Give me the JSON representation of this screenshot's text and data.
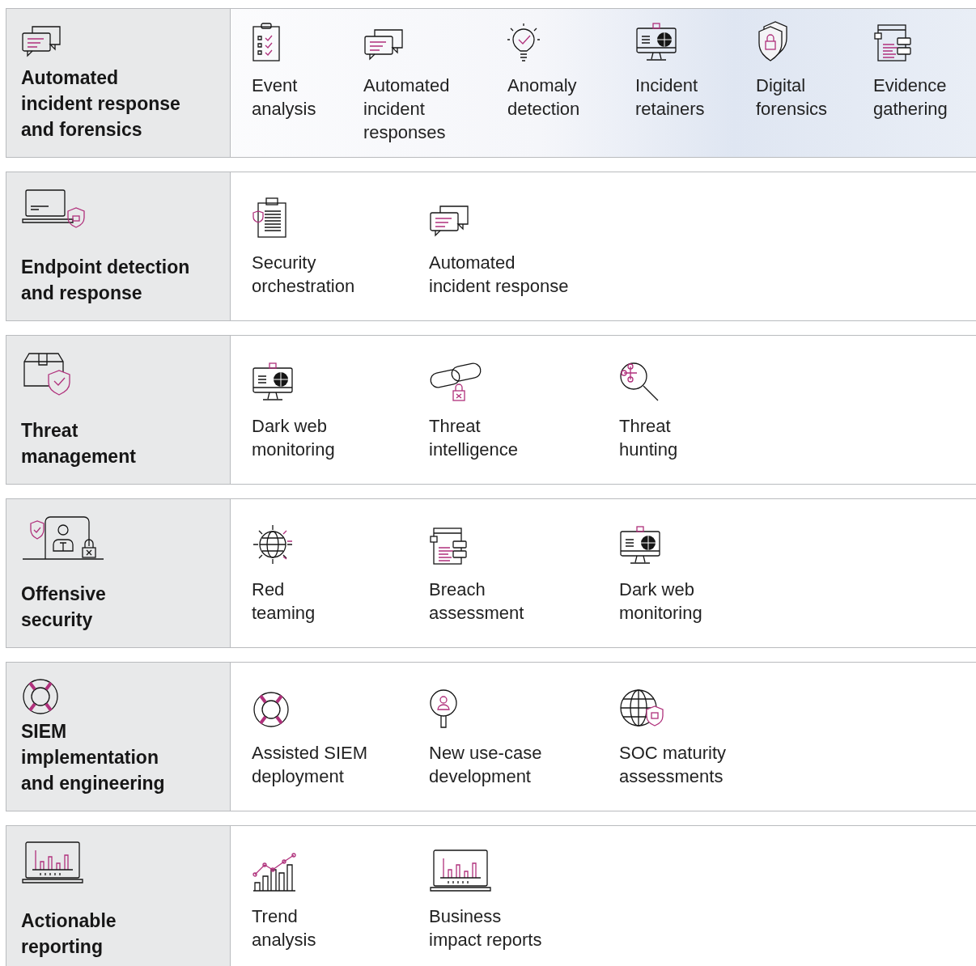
{
  "sections": [
    {
      "title": "Automated\nincident response\nand forensics",
      "items": [
        {
          "label": "Event\nanalysis"
        },
        {
          "label": "Automated\nincident\nresponses"
        },
        {
          "label": "Anomaly\ndetection"
        },
        {
          "label": "Incident\nretainers"
        },
        {
          "label": "Digital\nforensics"
        },
        {
          "label": "Evidence\ngathering"
        }
      ]
    },
    {
      "title": "Endpoint detection\nand response",
      "items": [
        {
          "label": "Security\norchestration"
        },
        {
          "label": "Automated\nincident response"
        }
      ]
    },
    {
      "title": "Threat\nmanagement",
      "items": [
        {
          "label": "Dark web\nmonitoring"
        },
        {
          "label": "Threat\nintelligence"
        },
        {
          "label": "Threat\nhunting"
        }
      ]
    },
    {
      "title": "Offensive\nsecurity",
      "items": [
        {
          "label": "Red\nteaming"
        },
        {
          "label": "Breach\nassessment"
        },
        {
          "label": "Dark web\nmonitoring"
        }
      ]
    },
    {
      "title": "SIEM\nimplementation\nand engineering",
      "items": [
        {
          "label": "Assisted SIEM\ndeployment"
        },
        {
          "label": "New use-case\ndevelopment"
        },
        {
          "label": "SOC maturity\nassessments"
        }
      ]
    },
    {
      "title": "Actionable\nreporting",
      "items": [
        {
          "label": "Trend\nanalysis"
        },
        {
          "label": "Business\nimpact reports"
        }
      ]
    }
  ]
}
